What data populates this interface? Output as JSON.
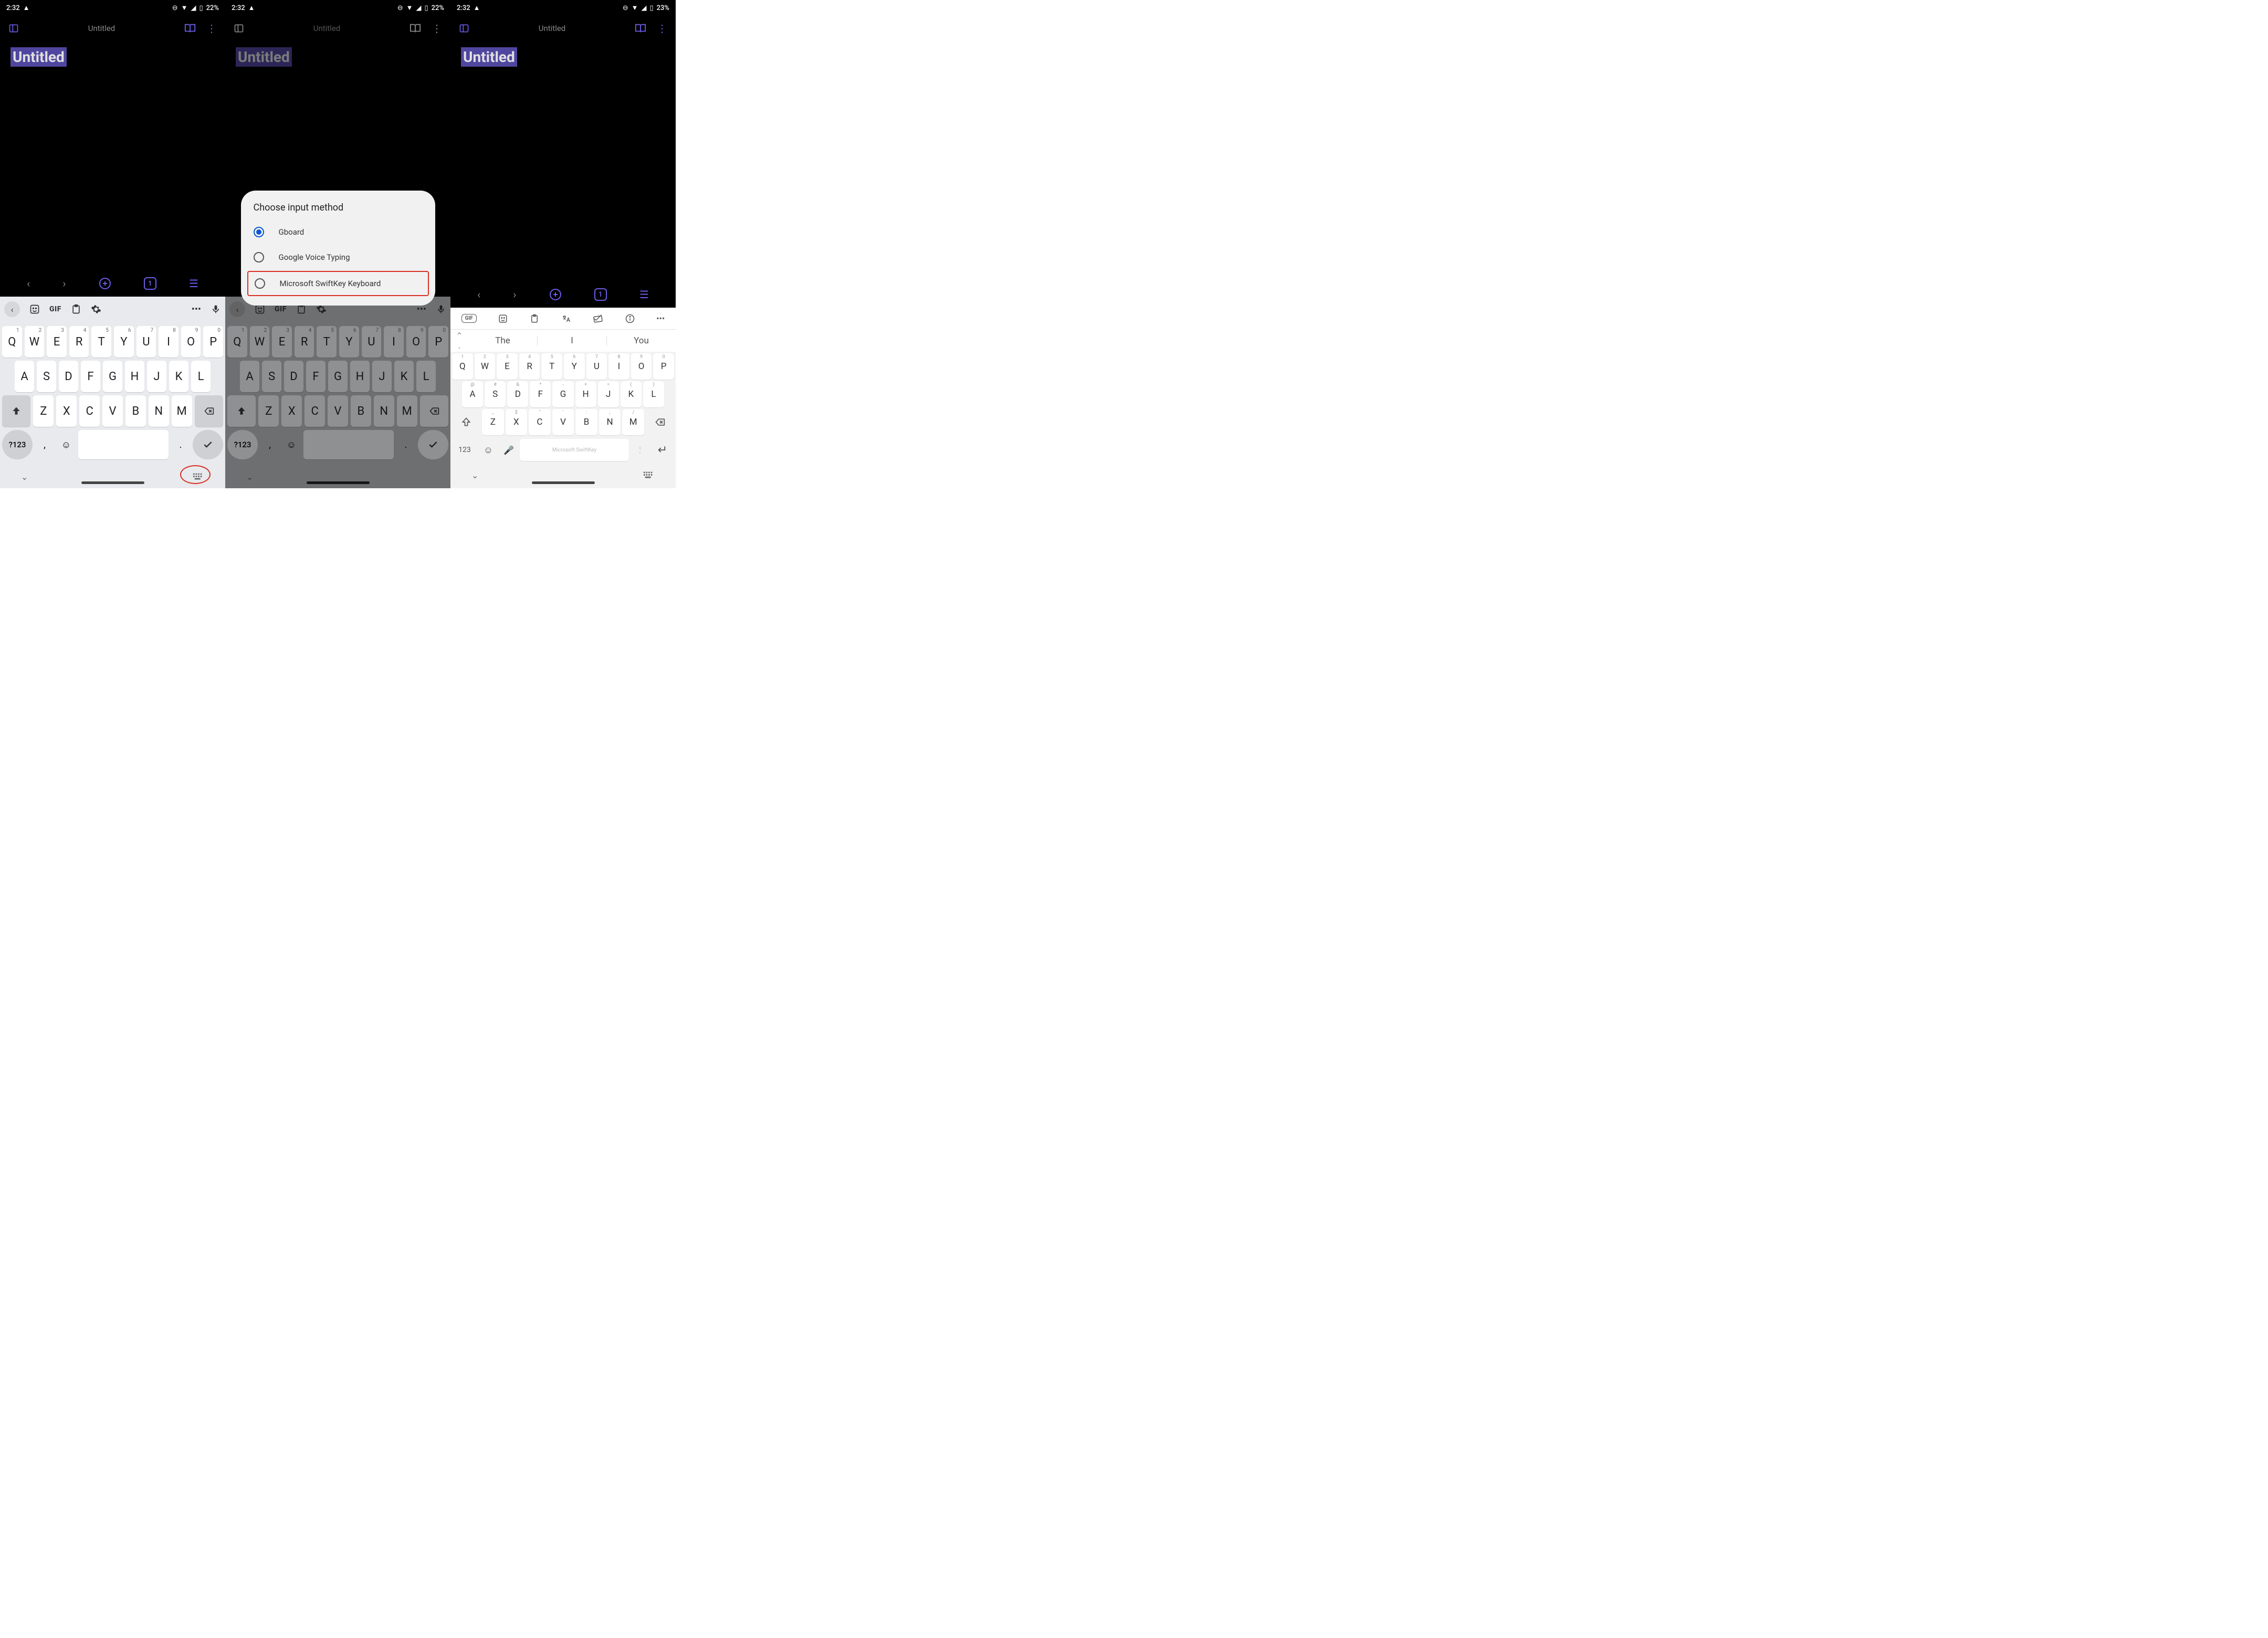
{
  "screens": [
    {
      "status": {
        "time": "2:32",
        "battery": "22%"
      },
      "app": {
        "title": "Untitled"
      },
      "doc": {
        "title": "Untitled"
      },
      "toolbar": {
        "page": "1"
      },
      "gboard": {
        "gif": "GIF",
        "rows": {
          "r1": [
            {
              "k": "Q",
              "s": "1"
            },
            {
              "k": "W",
              "s": "2"
            },
            {
              "k": "E",
              "s": "3"
            },
            {
              "k": "R",
              "s": "4"
            },
            {
              "k": "T",
              "s": "5"
            },
            {
              "k": "Y",
              "s": "6"
            },
            {
              "k": "U",
              "s": "7"
            },
            {
              "k": "I",
              "s": "8"
            },
            {
              "k": "O",
              "s": "9"
            },
            {
              "k": "P",
              "s": "0"
            }
          ],
          "r2": [
            "A",
            "S",
            "D",
            "F",
            "G",
            "H",
            "J",
            "K",
            "L"
          ],
          "r3": [
            "Z",
            "X",
            "C",
            "V",
            "B",
            "N",
            "M"
          ]
        },
        "num": "?123",
        "comma": ",",
        "period": "."
      }
    },
    {
      "status": {
        "time": "2:32",
        "battery": "22%"
      },
      "app": {
        "title": "Untitled"
      },
      "doc": {
        "title": "Untitled"
      },
      "dialog": {
        "title": "Choose input method",
        "items": [
          {
            "label": "Gboard",
            "selected": true
          },
          {
            "label": "Google Voice Typing",
            "selected": false
          },
          {
            "label": "Microsoft SwiftKey Keyboard",
            "selected": false,
            "highlight": true
          }
        ]
      }
    },
    {
      "status": {
        "time": "2:32",
        "battery": "23%"
      },
      "app": {
        "title": "Untitled"
      },
      "doc": {
        "title": "Untitled"
      },
      "toolbar": {
        "page": "1"
      },
      "swiftkey": {
        "sugg": [
          "The",
          "I",
          "You"
        ],
        "rows": {
          "r1": [
            {
              "k": "Q",
              "s": "1"
            },
            {
              "k": "W",
              "s": "2"
            },
            {
              "k": "E",
              "s": "3"
            },
            {
              "k": "R",
              "s": "4"
            },
            {
              "k": "T",
              "s": "5"
            },
            {
              "k": "Y",
              "s": "6"
            },
            {
              "k": "U",
              "s": "7"
            },
            {
              "k": "I",
              "s": "8"
            },
            {
              "k": "O",
              "s": "9"
            },
            {
              "k": "P",
              "s": "0"
            }
          ],
          "r2": [
            {
              "k": "A",
              "s": "@"
            },
            {
              "k": "S",
              "s": "#"
            },
            {
              "k": "D",
              "s": "&"
            },
            {
              "k": "F",
              "s": "*"
            },
            {
              "k": "G",
              "s": "-"
            },
            {
              "k": "H",
              "s": "+"
            },
            {
              "k": "J",
              "s": "="
            },
            {
              "k": "K",
              "s": "("
            },
            {
              "k": "L",
              "s": ")"
            }
          ],
          "r3": [
            {
              "k": "Z",
              "s": "_"
            },
            {
              "k": "X",
              "s": "$"
            },
            {
              "k": "C",
              "s": "\""
            },
            {
              "k": "V",
              "s": "'"
            },
            {
              "k": "B",
              "s": ":"
            },
            {
              "k": "N",
              "s": ";"
            },
            {
              "k": "M",
              "s": "/"
            }
          ]
        },
        "num": "123",
        "space": "Microsoft SwiftKey"
      }
    }
  ]
}
